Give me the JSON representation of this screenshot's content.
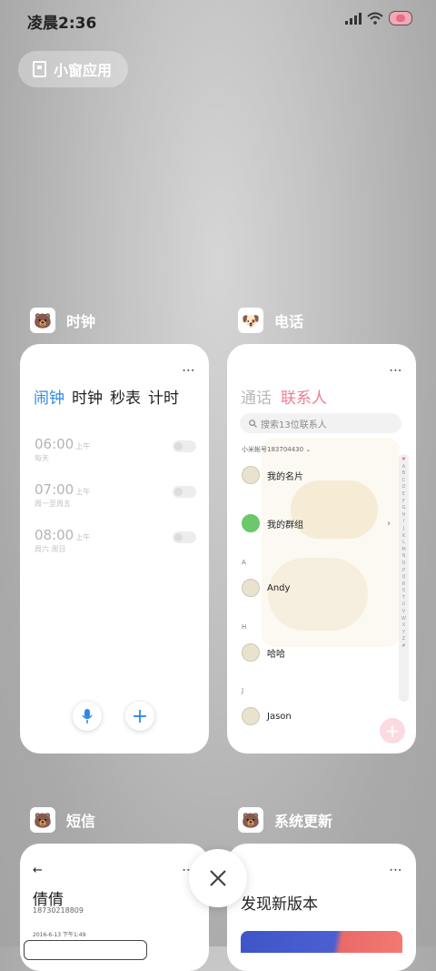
{
  "status": {
    "time": "凌晨2:36",
    "icons": [
      "signal-icon",
      "wifi-icon",
      "battery-icon"
    ]
  },
  "small_window": {
    "label": "小窗应用",
    "icon": "window-icon"
  },
  "apps": {
    "clock": {
      "name": "时钟",
      "tabs": [
        "闹钟",
        "时钟",
        "秒表",
        "计时"
      ],
      "alarms": [
        {
          "time": "06:00",
          "ampm": "上午",
          "repeat": "每天"
        },
        {
          "time": "07:00",
          "ampm": "上午",
          "repeat": "周一至周五"
        },
        {
          "time": "08:00",
          "ampm": "上午",
          "repeat": "周六 周日"
        }
      ],
      "accent": "#2f8ae6"
    },
    "phone": {
      "name": "电话",
      "tabs": [
        "通话",
        "联系人"
      ],
      "search_placeholder": "搜索13位联系人",
      "account": "小米帐号183704430",
      "rows": [
        {
          "label": "我的名片"
        },
        {
          "label": "我的群组"
        }
      ],
      "sections": [
        {
          "letter": "A",
          "name": "Andy"
        },
        {
          "letter": "H",
          "name": "哈哈"
        },
        {
          "letter": "J",
          "name": "Jason"
        }
      ],
      "index_letters": [
        "♥",
        "A",
        "B",
        "C",
        "D",
        "E",
        "F",
        "G",
        "H",
        "I",
        "J",
        "K",
        "L",
        "M",
        "N",
        "O",
        "P",
        "Q",
        "R",
        "S",
        "T",
        "U",
        "V",
        "W",
        "X",
        "Y",
        "Z",
        "#"
      ],
      "accent": "#ef7d93"
    },
    "sms": {
      "name": "短信",
      "contact": "倩倩",
      "number": "18730218809",
      "date": "2016-6-13 下午1:49"
    },
    "update": {
      "name": "系统更新",
      "title": "发现新版本"
    }
  }
}
